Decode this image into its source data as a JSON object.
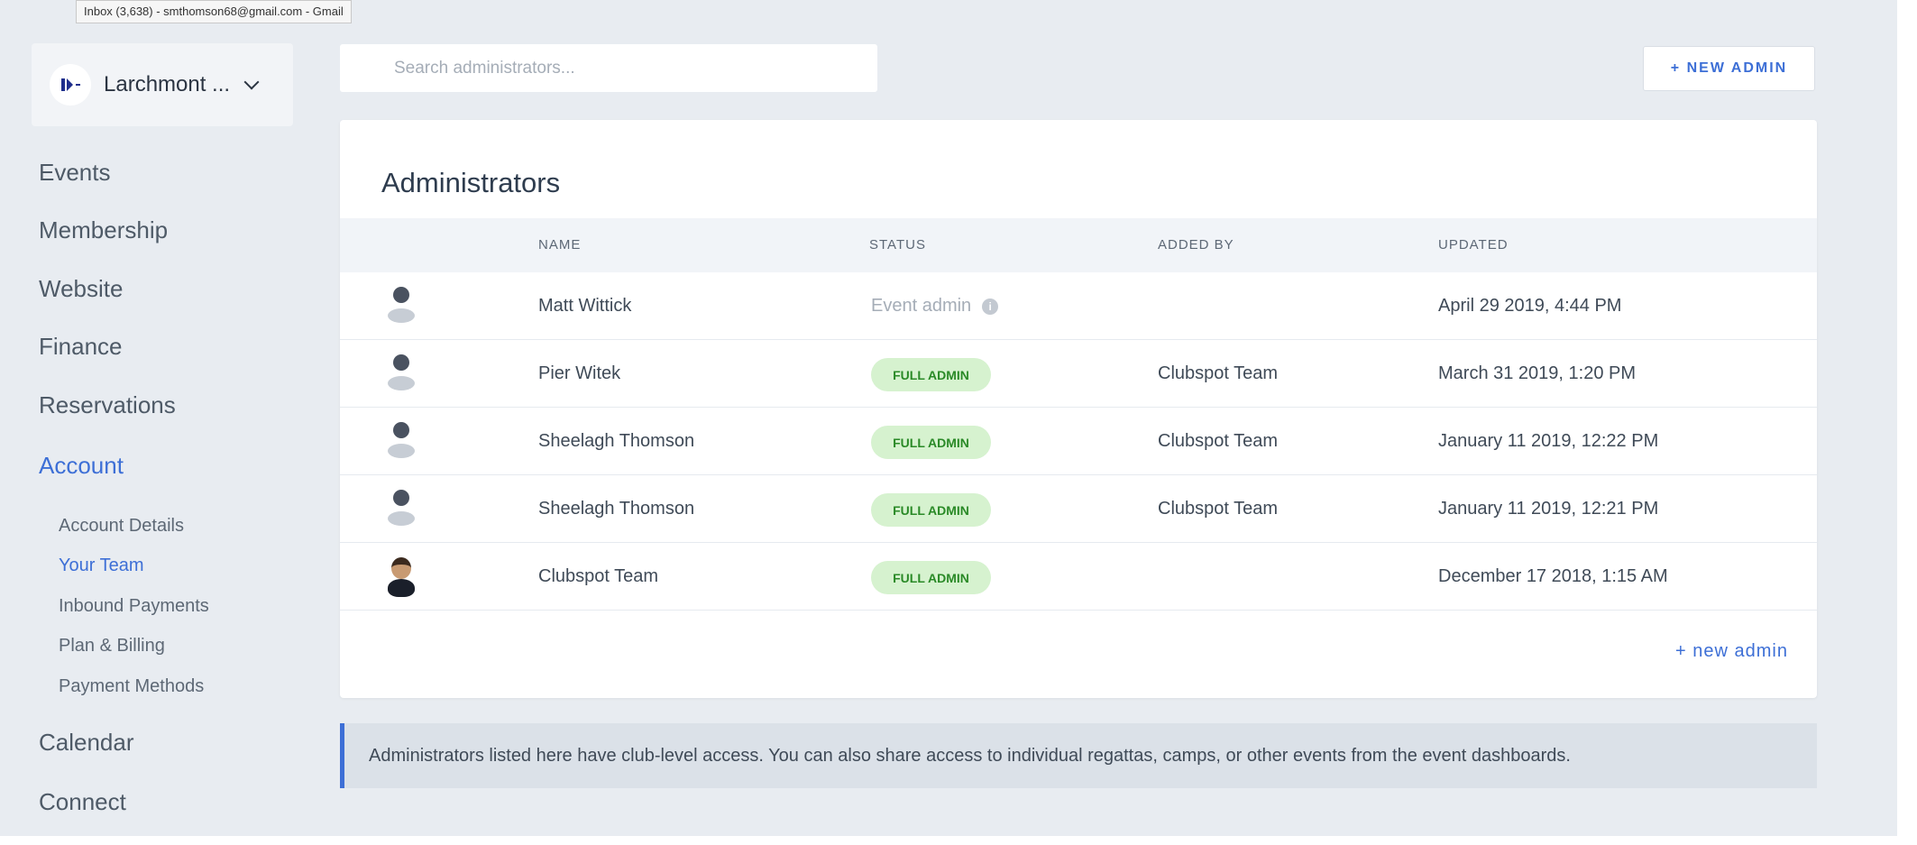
{
  "tooltip": "Inbox (3,638) - smthomson68@gmail.com - Gmail",
  "club": {
    "name": "Larchmont ...",
    "logo_icon": "club-logo-icon",
    "dropdown_icon": "chevron-down-icon"
  },
  "nav": {
    "events": "Events",
    "membership": "Membership",
    "website": "Website",
    "finance": "Finance",
    "reservations": "Reservations",
    "account": "Account",
    "account_sub": {
      "details": "Account Details",
      "team": "Your Team",
      "inbound": "Inbound Payments",
      "billing": "Plan & Billing",
      "methods": "Payment Methods"
    },
    "calendar": "Calendar",
    "connect": "Connect",
    "active_color": "#3d6fd6"
  },
  "search": {
    "placeholder": "Search administrators..."
  },
  "new_admin_button": "+ NEW ADMIN",
  "admins": {
    "title": "Administrators",
    "columns": {
      "name": "NAME",
      "status": "STATUS",
      "added_by": "ADDED BY",
      "updated": "UPDATED"
    },
    "rows": [
      {
        "avatar": "default-avatar-icon",
        "name": "Matt Wittick",
        "status": "Event admin",
        "added_by": "",
        "updated": "April 29 2019, 4:44 PM"
      },
      {
        "avatar": "default-avatar-icon",
        "name": "Pier Witek",
        "status": "FULL ADMIN",
        "added_by": "Clubspot Team",
        "updated": "March 31 2019, 1:20 PM"
      },
      {
        "avatar": "default-avatar-icon",
        "name": "Sheelagh Thomson",
        "status": "FULL ADMIN",
        "added_by": "Clubspot Team",
        "updated": "January 11 2019, 12:22 PM"
      },
      {
        "avatar": "default-avatar-icon",
        "name": "Sheelagh Thomson",
        "status": "FULL ADMIN",
        "added_by": "Clubspot Team",
        "updated": "January 11 2019, 12:21 PM"
      },
      {
        "avatar": "photo-avatar",
        "name": "Clubspot Team",
        "status": "FULL ADMIN",
        "added_by": "",
        "updated": "December 17 2018, 1:15 AM"
      }
    ],
    "info_icon": "i",
    "add_link": "+ new admin"
  },
  "notice": "Administrators listed here have club-level access. You can also share access to individual regattas, camps, or other events from the event dashboards.",
  "colors": {
    "accent": "#3d6fd6",
    "badge_bg": "#d6f2cf",
    "badge_text": "#2a8a27"
  }
}
